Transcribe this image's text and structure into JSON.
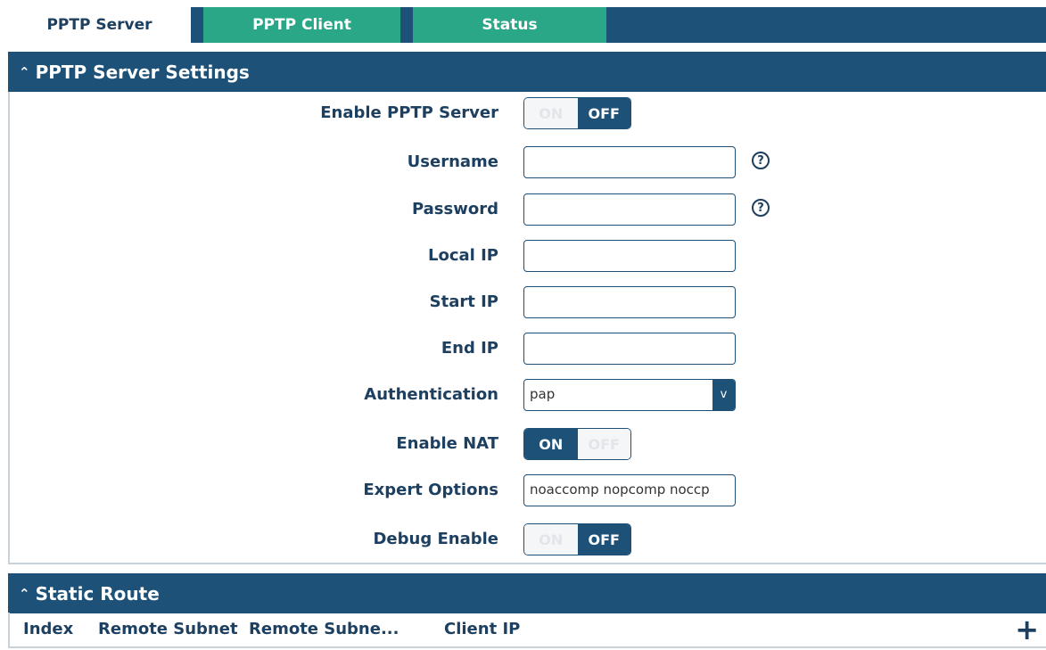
{
  "tabs": [
    {
      "label": "PPTP Server"
    },
    {
      "label": "PPTP Client"
    },
    {
      "label": "Status"
    }
  ],
  "server_settings": {
    "title": "PPTP Server Settings",
    "fields": {
      "enable_pptp_server": {
        "label": "Enable PPTP Server",
        "on_label": "ON",
        "off_label": "OFF",
        "state": "OFF"
      },
      "username": {
        "label": "Username",
        "value": ""
      },
      "password": {
        "label": "Password",
        "value": ""
      },
      "local_ip": {
        "label": "Local IP",
        "value": ""
      },
      "start_ip": {
        "label": "Start IP",
        "value": ""
      },
      "end_ip": {
        "label": "End IP",
        "value": ""
      },
      "authentication": {
        "label": "Authentication",
        "value": "pap"
      },
      "enable_nat": {
        "label": "Enable NAT",
        "on_label": "ON",
        "off_label": "OFF",
        "state": "ON"
      },
      "expert_options": {
        "label": "Expert Options",
        "value": "noaccomp nopcomp noccp"
      },
      "debug_enable": {
        "label": "Debug Enable",
        "on_label": "ON",
        "off_label": "OFF",
        "state": "OFF"
      }
    },
    "help_glyph": "?"
  },
  "static_route": {
    "title": "Static Route",
    "columns": [
      "Index",
      "Remote Subnet",
      "Remote Subne...",
      "Client IP"
    ],
    "add_glyph": "+"
  },
  "icons": {
    "section_chevron": "chevron-up-icon",
    "help": "question-circle-icon",
    "select_arrow": "chevron-down-icon",
    "add": "plus-icon"
  },
  "colors": {
    "header_bg": "#1e5178",
    "tab_green": "#2aa786",
    "text": "#1d3f60"
  }
}
